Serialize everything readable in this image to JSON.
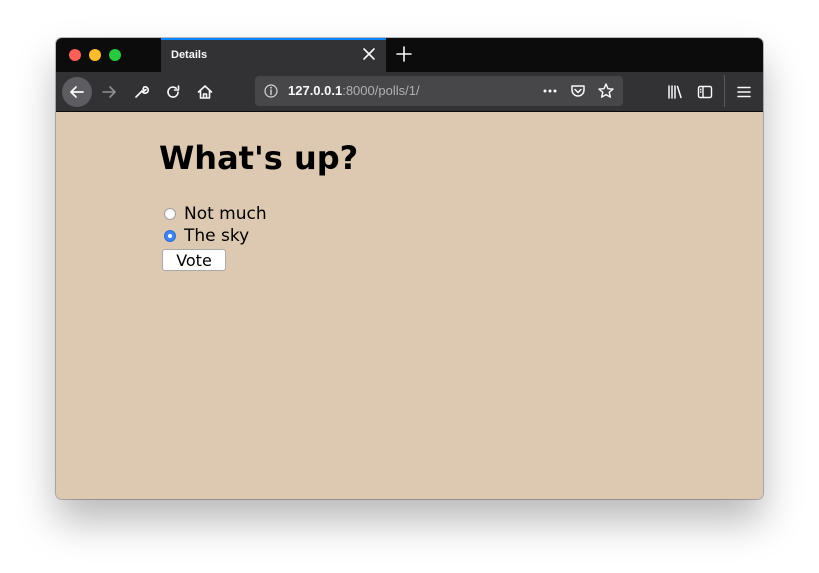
{
  "browser": {
    "tab": {
      "title": "Details"
    },
    "url": {
      "host": "127.0.0.1",
      "rest": ":8000/polls/1/"
    },
    "icons": [
      "back-icon",
      "forward-icon",
      "wrench-icon",
      "reload-icon",
      "home-icon",
      "info-icon",
      "page-actions-icon",
      "pocket-icon",
      "bookmark-star-icon",
      "library-icon",
      "sidebar-icon",
      "hamburger-menu-icon",
      "close-icon",
      "plus-icon"
    ],
    "colors": {
      "tab_accent": "#0a84ff",
      "chrome_dark": "#0c0c0d",
      "chrome_toolbar": "#323234"
    }
  },
  "page": {
    "background": "#ddc9b1",
    "question": "What's up?",
    "choices": [
      {
        "label": "Not much",
        "selected": false
      },
      {
        "label": "The sky",
        "selected": true
      }
    ],
    "vote_label": "Vote"
  }
}
